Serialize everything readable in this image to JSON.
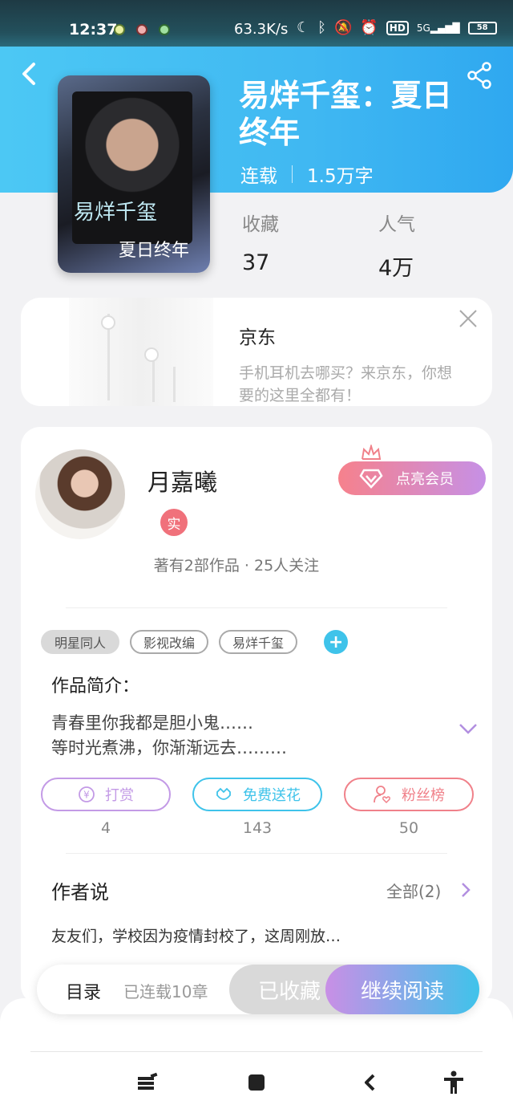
{
  "status_bar": {
    "time": "12:37",
    "speed": "63.3K/s",
    "network": "HD",
    "signal": "5G",
    "battery": "58"
  },
  "book": {
    "cover_text_1": "易烊千玺",
    "cover_text_2": "夏日终年",
    "title": "易烊千玺：夏日终年",
    "status": "连载",
    "word_count": "1.5万字",
    "stats": [
      {
        "label": "收藏",
        "value": "37"
      },
      {
        "label": "人气",
        "value": "4万"
      }
    ]
  },
  "ad": {
    "title": "京东",
    "description": "手机耳机去哪买？来京东，你想要的这里全都有！"
  },
  "author": {
    "name": "月嘉曦",
    "verified_badge": "实",
    "vip_button": "点亮会员",
    "stats": "著有2部作品 · 25人关注"
  },
  "tags": [
    "明星同人",
    "影视改编",
    "易烊千玺"
  ],
  "tag_add": "+",
  "intro": {
    "title": "作品简介：",
    "line1": "青春里你我都是胆小鬼……",
    "line2": "等时光煮沸，你渐渐远去………"
  },
  "actions": [
    {
      "label": "打赏",
      "count": "4",
      "color": "#c39ae6"
    },
    {
      "label": "免费送花",
      "count": "143",
      "color": "#3fc3ea"
    },
    {
      "label": "粉丝榜",
      "count": "50",
      "color": "#f0818a"
    }
  ],
  "author_says": {
    "title": "作者说",
    "all_label": "全部(2)",
    "preview": "友友们，学校因为疫情封校了，这周刚放…"
  },
  "bottom_bar": {
    "toc": "目录",
    "chapters": "已连载10章",
    "favorited": "已收藏",
    "continue": "继续阅读"
  },
  "colors": {
    "header": "#40b8f2",
    "accent_blue": "#3fc3ea",
    "accent_purple": "#c98fe6",
    "accent_pink": "#f6818c"
  }
}
